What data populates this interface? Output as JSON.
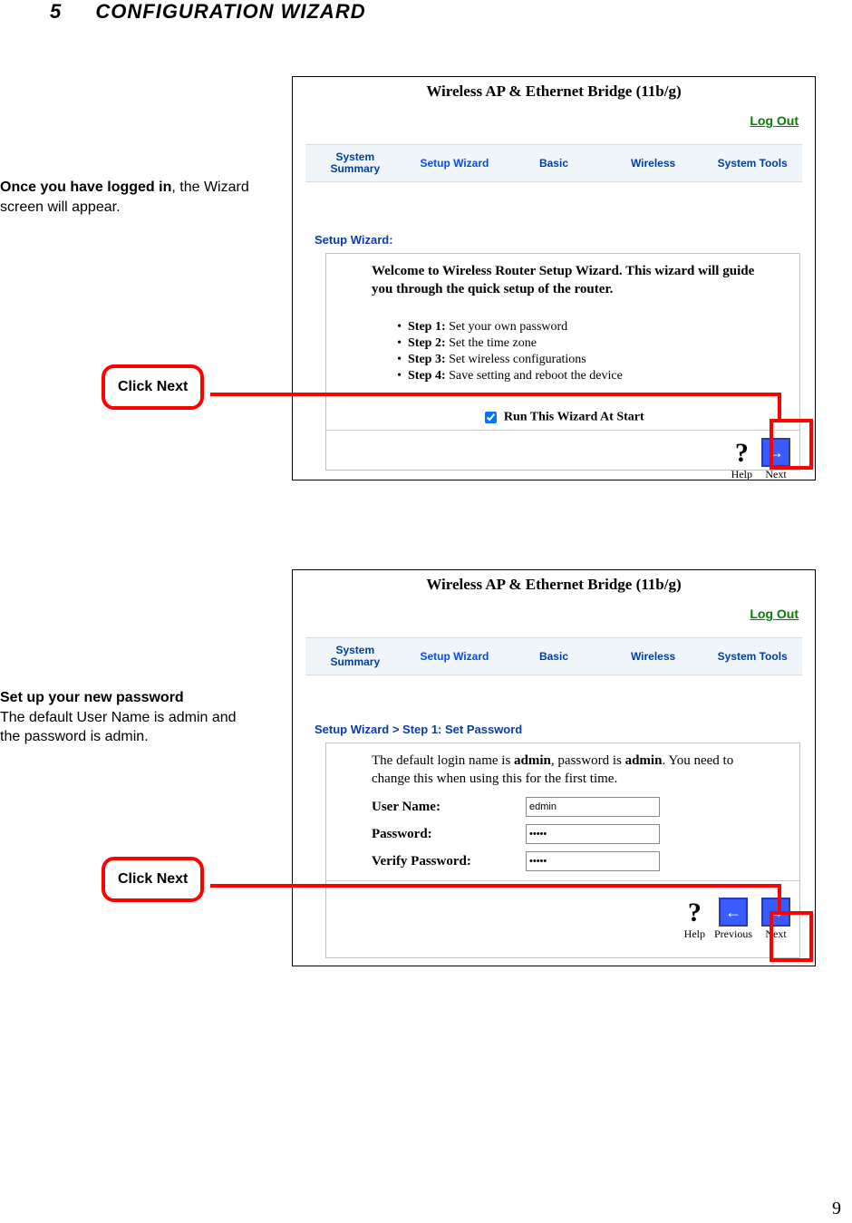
{
  "heading": {
    "num": "5",
    "title": "CONFIGURATION WIZARD"
  },
  "caption1": {
    "bold": "Once you have logged in",
    "rest": ", the Wizard screen will appear."
  },
  "caption2": {
    "bold": "Set up your new password",
    "rest": " The default User Name is admin and the password is admin."
  },
  "callout1": "Click Next",
  "callout2": "Click Next",
  "page_number": "9",
  "shot1": {
    "title": "Wireless AP & Ethernet Bridge (11b/g)",
    "logout": "Log Out",
    "tabs": [
      "System\nSummary",
      "Setup Wizard",
      "Basic",
      "Wireless",
      "System Tools"
    ],
    "active_tab_index": 1,
    "breadcrumb": "Setup Wizard:",
    "welcome": "Welcome to Wireless Router Setup Wizard. This wizard will guide you through the quick setup of the router.",
    "steps": [
      {
        "n": "Step 1:",
        "t": " Set your own password"
      },
      {
        "n": "Step 2:",
        "t": " Set the time zone"
      },
      {
        "n": "Step 3:",
        "t": " Set wireless configurations"
      },
      {
        "n": "Step 4:",
        "t": " Save setting and reboot the device"
      }
    ],
    "run_label": "Run This Wizard At Start",
    "nav": {
      "help": "Help",
      "next": "Next"
    }
  },
  "shot2": {
    "title": "Wireless AP & Ethernet Bridge (11b/g)",
    "logout": "Log Out",
    "tabs": [
      "System\nSummary",
      "Setup Wizard",
      "Basic",
      "Wireless",
      "System Tools"
    ],
    "active_tab_index": 1,
    "breadcrumb": "Setup Wizard > Step 1: Set Password",
    "intro_pre": "The default login name is ",
    "intro_b1": "admin",
    "intro_mid": ", password is ",
    "intro_b2": "admin",
    "intro_post": ". You need to change this when using this for the first time.",
    "fields": {
      "user_label": "User Name:",
      "user_value": "edmin",
      "pass_label": "Password:",
      "pass_value": "•••••",
      "verify_label": "Verify Password:",
      "verify_value": "•••••"
    },
    "nav": {
      "help": "Help",
      "previous": "Previous",
      "next": "Next"
    }
  }
}
